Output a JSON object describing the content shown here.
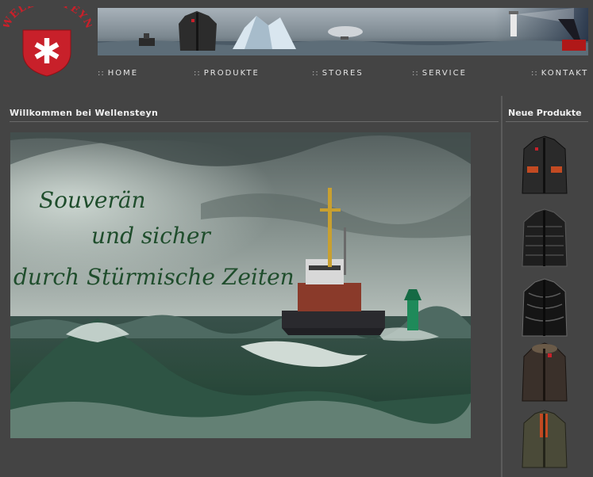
{
  "brand": {
    "logo_text": "WELLENSTEYN",
    "accent": "#c8202a"
  },
  "nav": {
    "prefix": "::",
    "items": [
      {
        "label": "HOME"
      },
      {
        "label": "PRODUKTE"
      },
      {
        "label": "STORES"
      },
      {
        "label": "SERVICE"
      },
      {
        "label": "KONTAKT"
      }
    ]
  },
  "main": {
    "title": "Willkommen bei Wellensteyn",
    "hero_lines": [
      "Souverän",
      "und sicher",
      "durch Stürmische Zeiten"
    ]
  },
  "sidebar": {
    "title": "Neue Produkte",
    "products": [
      {
        "icon": "jacket-icon",
        "color": "#2a2a2a"
      },
      {
        "icon": "jacket-icon",
        "color": "#1e1e1e"
      },
      {
        "icon": "jacket-icon",
        "color": "#151515"
      },
      {
        "icon": "jacket-icon",
        "color": "#3a302a"
      },
      {
        "icon": "jacket-icon",
        "color": "#4a4a38"
      }
    ]
  }
}
